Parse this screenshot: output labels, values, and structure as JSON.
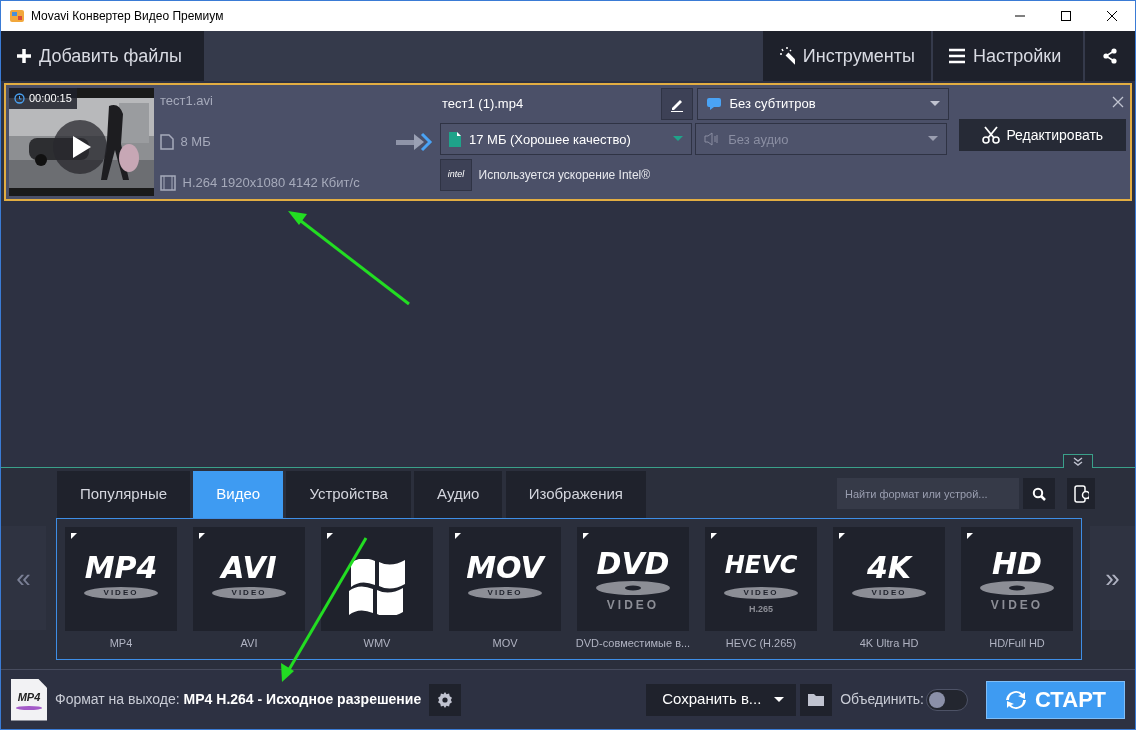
{
  "window": {
    "title": "Movavi Конвертер Видео Премиум"
  },
  "toolbar": {
    "add_files": "Добавить файлы",
    "tools": "Инструменты",
    "settings": "Настройки"
  },
  "file": {
    "duration": "00:00:15",
    "source_name": "тест1.avi",
    "source_size": "8 МБ",
    "source_codec": "H.264 1920x1080 4142 Кбит/с",
    "output_name": "тест1 (1).mp4",
    "output_size": "17 МБ (Хорошее качество)",
    "subtitles": "Без субтитров",
    "audio": {
      "label": "Без аудио",
      "disabled": true
    },
    "edit": "Редактировать",
    "intel_logo": "intel",
    "acceleration": "Используется ускорение Intel®"
  },
  "formats": {
    "tabs": [
      {
        "label": "Популярные",
        "selected": false
      },
      {
        "label": "Видео",
        "selected": true
      },
      {
        "label": "Устройства",
        "selected": false
      },
      {
        "label": "Аудио",
        "selected": false
      },
      {
        "label": "Изображения",
        "selected": false
      }
    ],
    "search": {
      "placeholder": "Найти формат или устрой..."
    },
    "prev": "«",
    "next": "»",
    "tiles": [
      {
        "kind": "ellipse",
        "logo": "MP4",
        "badge": "VIDEO",
        "label": "MP4"
      },
      {
        "kind": "ellipse",
        "logo": "AVI",
        "badge": "VIDEO",
        "label": "AVI"
      },
      {
        "kind": "windows",
        "label": "WMV"
      },
      {
        "kind": "ellipse",
        "logo": "MOV",
        "badge": "VIDEO",
        "label": "MOV"
      },
      {
        "kind": "disc",
        "logo": "DVD",
        "badge": "VIDEO",
        "label": "DVD-совместимые в..."
      },
      {
        "kind": "ellipse",
        "logo": "HEVC",
        "badge": "VIDEO",
        "sub": "H.265",
        "label": "HEVC (H.265)"
      },
      {
        "kind": "ellipse",
        "logo": "4K",
        "badge": "VIDEO",
        "label": "4K Ultra HD"
      },
      {
        "kind": "disc",
        "logo": "HD",
        "badge": "VIDEO",
        "label": "HD/Full HD"
      }
    ]
  },
  "footer": {
    "format_icon": "MP4",
    "format_label": "Формат на выходе:",
    "format_value": "MP4 H.264 - Исходное разрешение",
    "save": "Сохранить в...",
    "combine": {
      "label": "Объединить:",
      "on": false
    },
    "start": "СТАРТ"
  }
}
